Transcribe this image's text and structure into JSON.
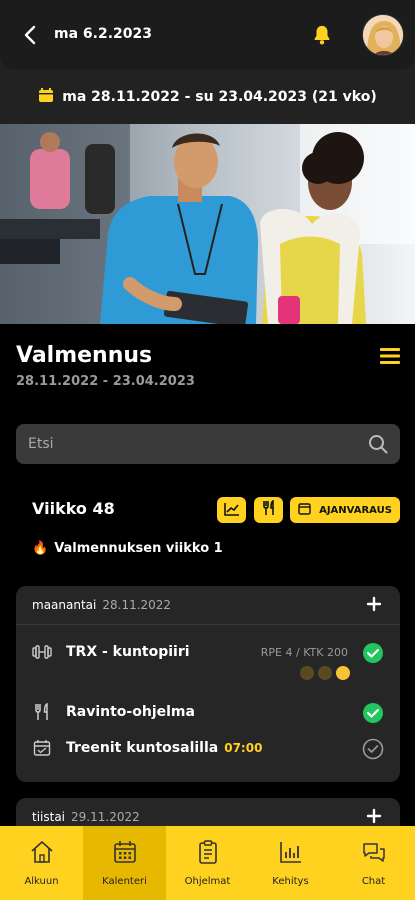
{
  "header": {
    "date": "ma 6.2.2023",
    "period": "ma 28.11.2022 - su 23.04.2023 (21 vko)"
  },
  "program": {
    "title": "Valmennus",
    "dates": "28.11.2022 - 23.04.2023",
    "search_placeholder": "Etsi"
  },
  "week": {
    "label": "Viikko 48",
    "booking_label": "AJANVARAUS",
    "theme_emoji": "🔥",
    "theme": "Valmennuksen viikko 1"
  },
  "days": [
    {
      "name": "maanantai",
      "date": "28.11.2022",
      "items": [
        {
          "title": "TRX - kuntopiiri",
          "meta": "RPE 4 / KTK 200",
          "status": "done"
        },
        {
          "title": "Ravinto-ohjelma",
          "status": "done"
        },
        {
          "title": "Treenit kuntosalilla",
          "time": "07:00",
          "status": "pending"
        }
      ]
    },
    {
      "name": "tiistai",
      "date": "29.11.2022"
    }
  ],
  "nav": [
    {
      "label": "Alkuun",
      "icon": "home-icon"
    },
    {
      "label": "Kalenteri",
      "icon": "calendar-icon",
      "active": true
    },
    {
      "label": "Ohjelmat",
      "icon": "clipboard-icon"
    },
    {
      "label": "Kehitys",
      "icon": "bar-chart-icon"
    },
    {
      "label": "Chat",
      "icon": "chat-icon"
    }
  ],
  "colors": {
    "accent": "#ffd21f",
    "success": "#22c55e",
    "background": "#000000",
    "card": "#262626"
  }
}
